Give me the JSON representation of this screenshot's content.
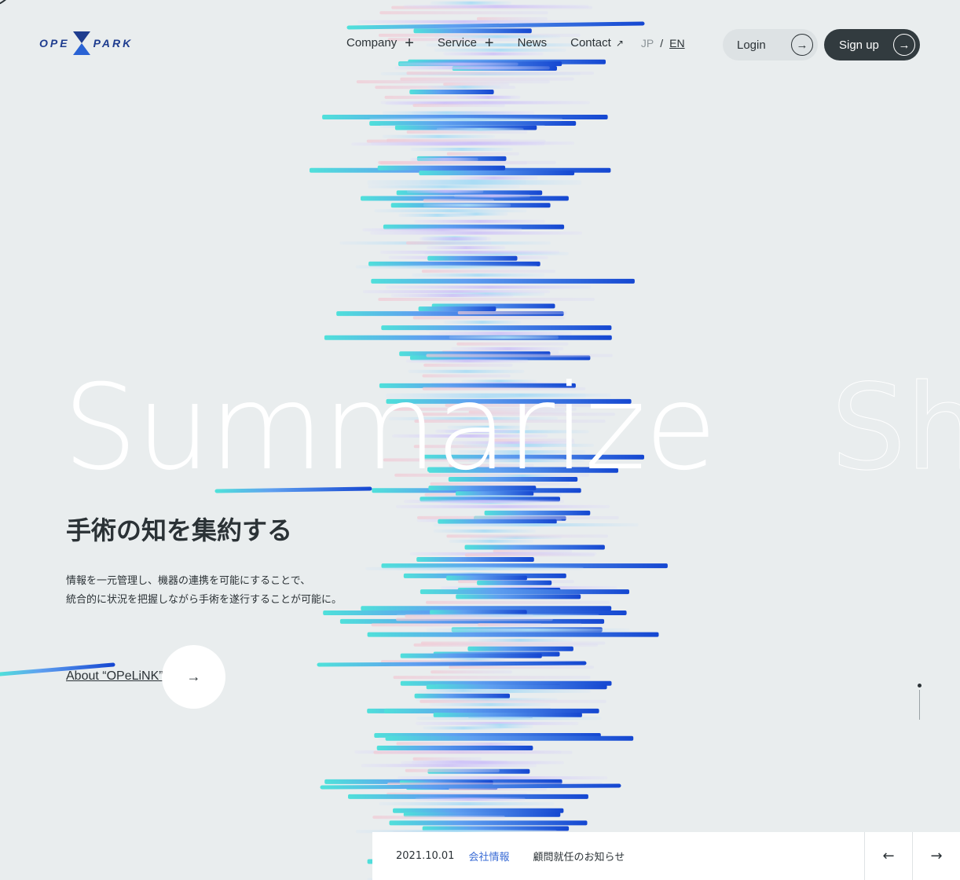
{
  "brand": {
    "left": "OPE",
    "right": "PARK"
  },
  "nav": {
    "company": "Company",
    "service": "Service",
    "news": "News",
    "contact": "Contact",
    "lang_jp": "JP",
    "lang_sep": "/",
    "lang_en": "EN"
  },
  "auth": {
    "login": "Login",
    "signup": "Sign up",
    "arrow": "→"
  },
  "hero": {
    "word": "Summarize",
    "next_word": "Sh",
    "title": "手術の知を集約する",
    "desc_line1": "情報を一元管理し、機器の連携を可能にすることで、",
    "desc_line2": "統合的に状況を把握しながら手術を遂行することが可能に。",
    "about_link": "About “OPeLiNK”",
    "about_arrow": "→"
  },
  "news": {
    "date": "2021.10.01",
    "category": "会社情報",
    "title": "顧問就任のお知らせ",
    "prev": "←",
    "next": "→"
  },
  "colors": {
    "background": "#e9edee",
    "dark": "#323b3f",
    "accent_blue": "#1547d1",
    "accent_cyan": "#4fe0da",
    "category_blue": "#3a6cd6"
  }
}
